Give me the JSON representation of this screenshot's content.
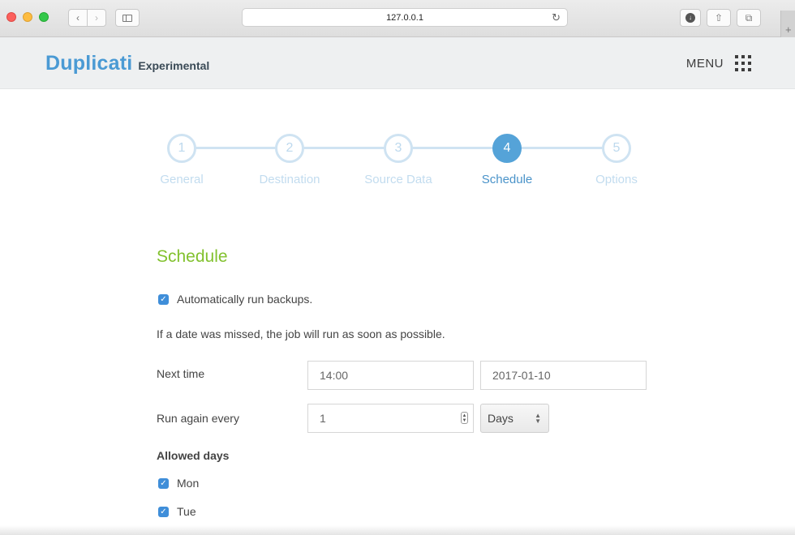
{
  "browser": {
    "url": "127.0.0.1",
    "reload_icon": "↻",
    "back_icon": "‹",
    "forward_icon": "›",
    "download_icon": "↓",
    "share_icon": "⇧",
    "tabs_icon": "⧉",
    "new_tab_icon": "+"
  },
  "header": {
    "brand": "Duplicati",
    "brand_sub": "Experimental",
    "menu_label": "MENU"
  },
  "steps": [
    {
      "number": "1",
      "label": "General",
      "active": false
    },
    {
      "number": "2",
      "label": "Destination",
      "active": false
    },
    {
      "number": "3",
      "label": "Source Data",
      "active": false
    },
    {
      "number": "4",
      "label": "Schedule",
      "active": true
    },
    {
      "number": "5",
      "label": "Options",
      "active": false
    }
  ],
  "schedule": {
    "title": "Schedule",
    "auto_run": {
      "label": "Automatically run backups.",
      "checked": true
    },
    "help_text": "If a date was missed, the job will run as soon as possible.",
    "next_time": {
      "label": "Next time",
      "time": "14:00",
      "date": "2017-01-10"
    },
    "run_again": {
      "label": "Run again every",
      "value": "1",
      "unit": "Days"
    },
    "allowed_days": {
      "label": "Allowed days",
      "days": [
        {
          "label": "Mon",
          "checked": true
        },
        {
          "label": "Tue",
          "checked": true
        }
      ]
    }
  },
  "colors": {
    "brand": "#4a9ad4",
    "accent_green": "#82c12e",
    "step_active": "#55a3d8",
    "step_inactive": "#cfe3f2",
    "checkbox": "#3f8ed9"
  }
}
